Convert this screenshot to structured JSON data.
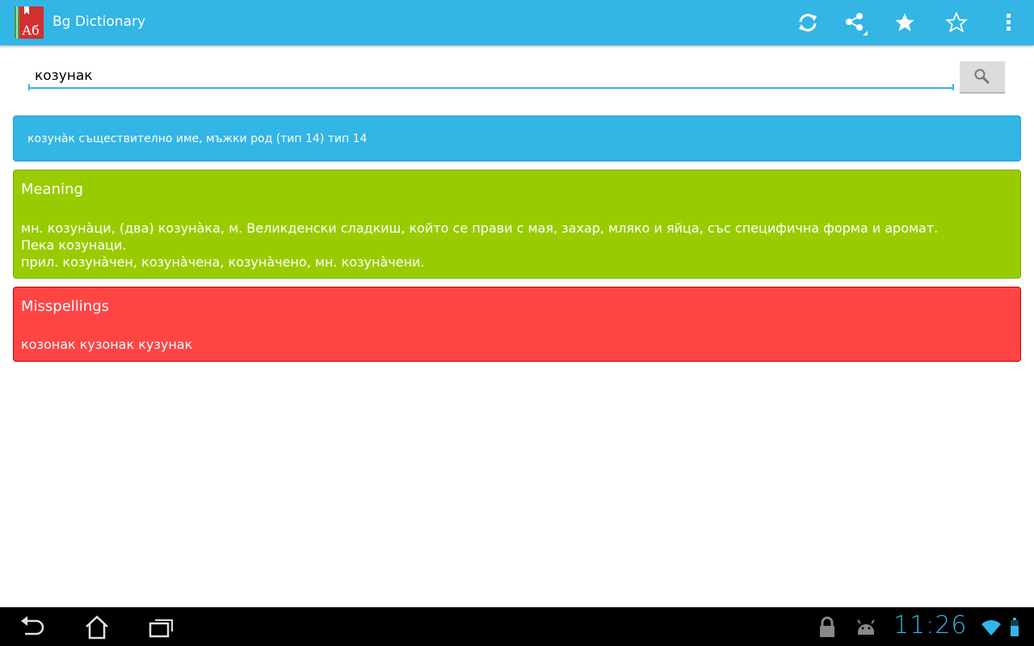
{
  "action_bar": {
    "title": "Bg Dictionary",
    "logo_text": "Аб",
    "color": "#33b5e5",
    "icons": [
      "refresh-icon",
      "share-icon",
      "star-filled-icon",
      "star-outline-icon",
      "overflow-menu-icon"
    ]
  },
  "search": {
    "value": "козунак",
    "button_icon": "search-icon"
  },
  "word_card": {
    "text": "козуна̀к съществително име, мъжки род (тип 14) тип 14",
    "color": "#33b5e5"
  },
  "meaning_card": {
    "title": "Meaning",
    "line1": "мн. козуна̀ци, (два) козуна̀ка, м. Великденски сладкиш, който се прави с мая, захар, мляко и яйца, със специфична форма и аромат. Пека козунаци.",
    "line2": "прил. козуна̀чен, козуна̀чена, козуна̀чено, мн. козуна̀чени.",
    "color": "#99cc00"
  },
  "misspellings_card": {
    "title": "Misspellings",
    "text": "козонак кузонак кузунак",
    "color": "#ff4444"
  },
  "nav_bar": {
    "icons": [
      "back-icon",
      "home-icon",
      "recent-apps-icon"
    ],
    "status_icons": [
      "lock-icon",
      "android-debug-icon",
      "wifi-icon",
      "battery-icon"
    ],
    "clock": "11:26"
  }
}
